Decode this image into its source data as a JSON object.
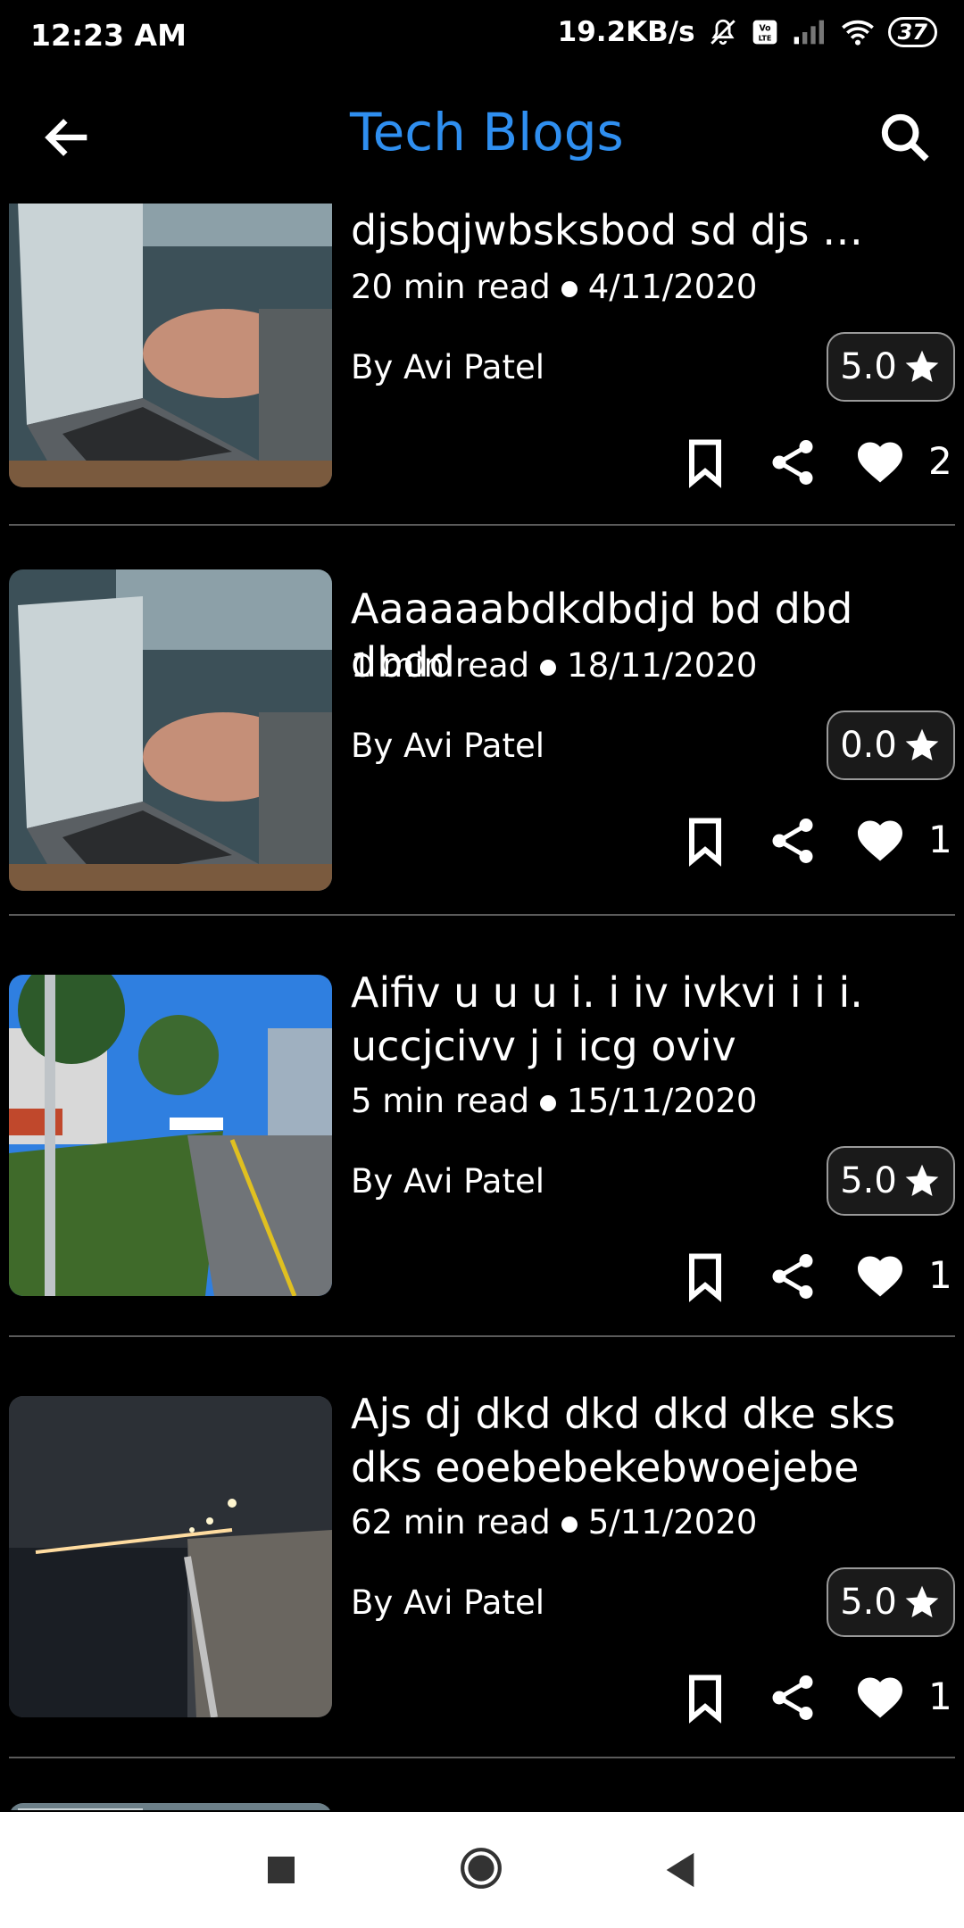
{
  "status": {
    "time": "12:23 AM",
    "speed": "19.2KB/s",
    "battery": "37"
  },
  "appbar": {
    "title": "Tech Blogs"
  },
  "posts": [
    {
      "title": "djsbqjwbsksbod sd djs …",
      "read": "20 min read",
      "date": "4/11/2020",
      "author": "By Avi Patel",
      "rating": "5.0",
      "likes": "2",
      "image": "laptop-typing"
    },
    {
      "title": "Aaaaaabdkdbdjd bd dbd dbdd",
      "read": "1 min read",
      "date": "18/11/2020",
      "author": "By Avi Patel",
      "rating": "0.0",
      "likes": "1",
      "image": "laptop-typing"
    },
    {
      "title": "Aifiv u u u i. i iv ivkvi i i i. uccjcivv j i icg oviv",
      "read": "5 min read",
      "date": "15/11/2020",
      "author": "By Avi Patel",
      "rating": "5.0",
      "likes": "1",
      "image": "street-trees"
    },
    {
      "title": "Ajs dj dkd dkd dkd dke sks dks eoebebekebwoejebe",
      "read": "62 min read",
      "date": "5/11/2020",
      "author": "By Avi Patel",
      "rating": "5.0",
      "likes": "1",
      "image": "night-waterfront"
    }
  ],
  "colors": {
    "title": "#2f8ff0",
    "background": "#000000"
  }
}
